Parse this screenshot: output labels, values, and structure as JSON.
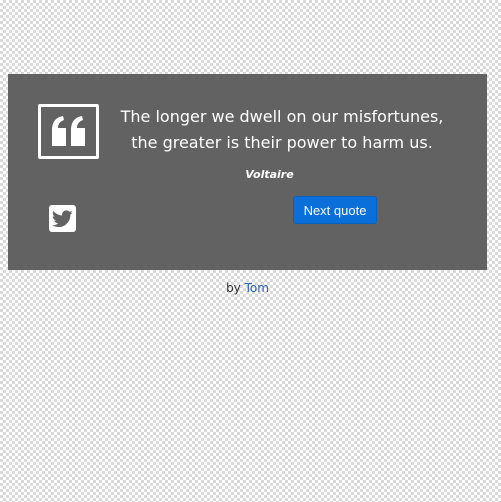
{
  "quote": {
    "text": "The longer we dwell on our misfortunes, the greater is their power to harm us.",
    "author": "Voltaire",
    "icon": "quote-icon"
  },
  "actions": {
    "tweet_icon": "twitter-icon",
    "next_label": "Next quote"
  },
  "credit": {
    "prefix": "by",
    "author_link": "Tom"
  },
  "colors": {
    "box_background": "#626262",
    "button_blue": "#0a6fd8",
    "link_blue": "#2b63b0",
    "text_white": "#ffffff"
  }
}
